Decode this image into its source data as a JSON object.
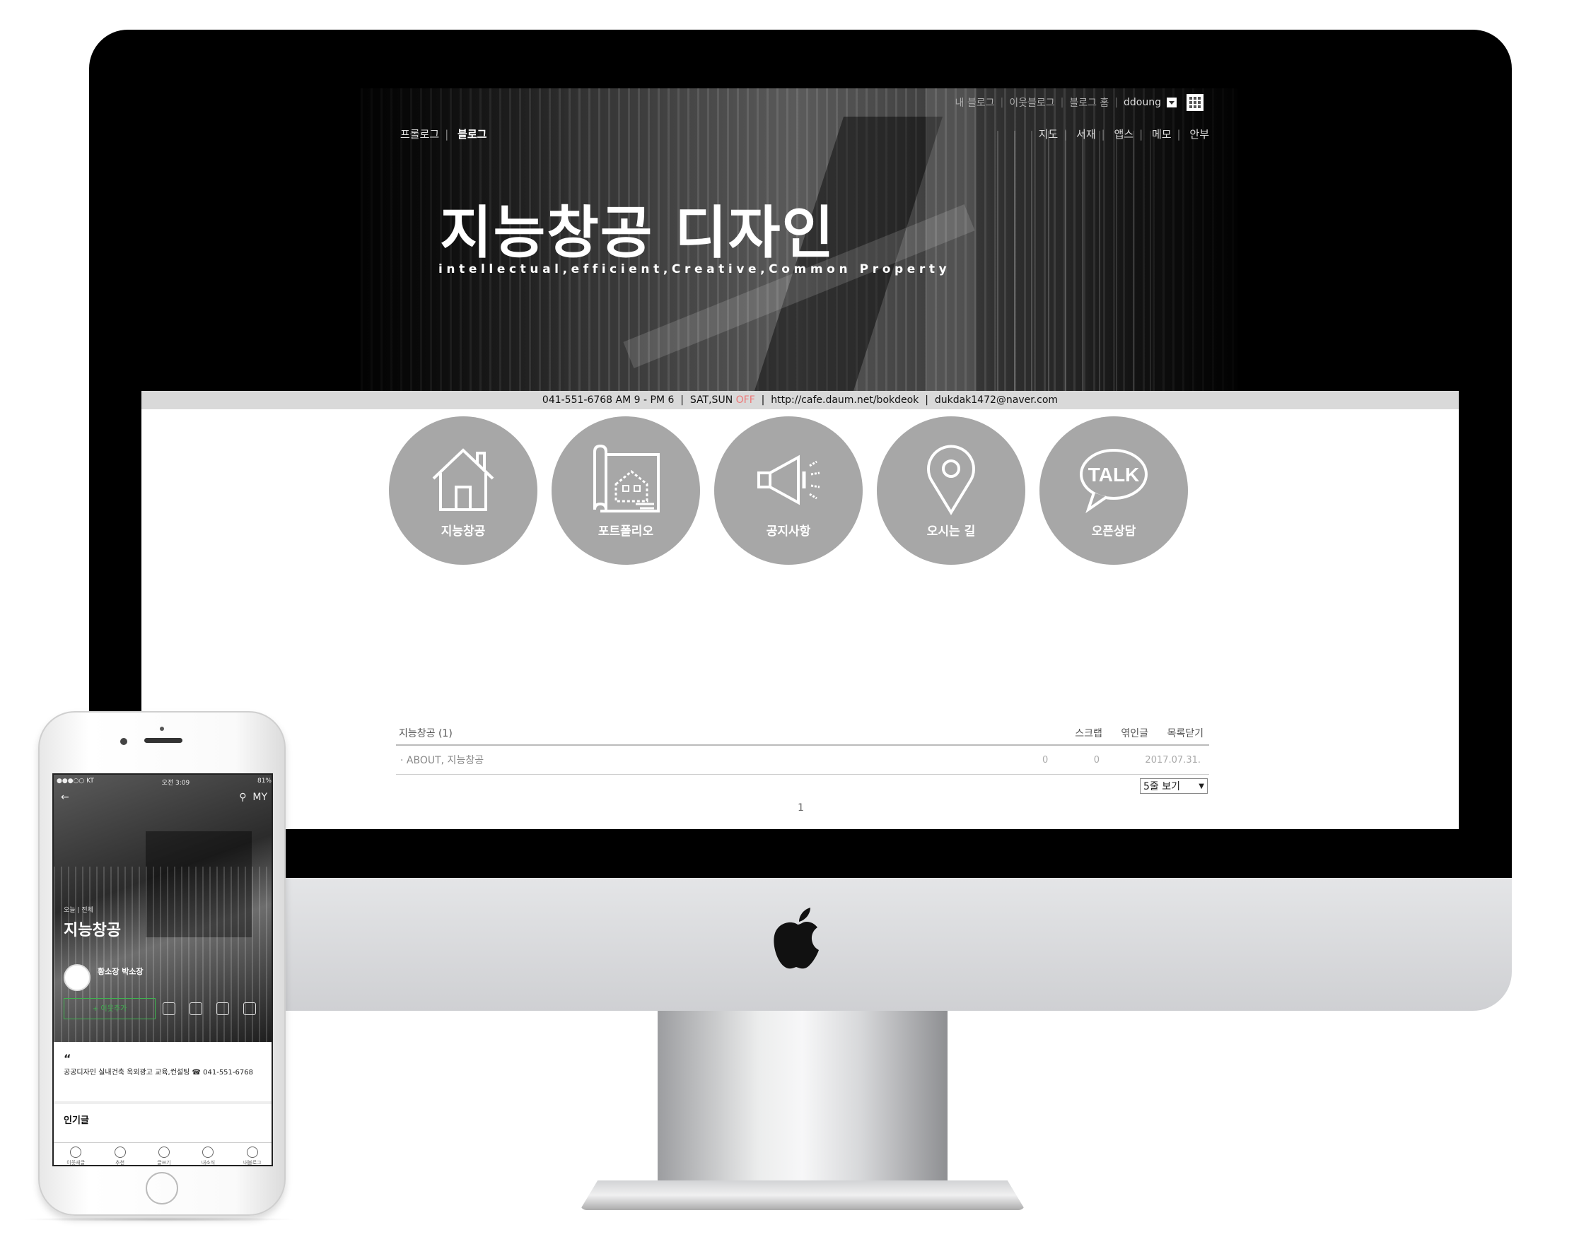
{
  "desktop": {
    "top_links": [
      "내 블로그",
      "이웃블로그",
      "블로그 홈"
    ],
    "user": "ddoung",
    "nav_left": [
      "프롤로그",
      "블로그"
    ],
    "nav_right": [
      "지도",
      "서재",
      "앱스",
      "메모",
      "안부"
    ],
    "title": "지능창공 디자인",
    "subtitle": "intellectual,efficient,Creative,Common Property",
    "infobar": {
      "hours": "041-551-6768 AM 9 - PM 6",
      "weekend": "SAT,SUN",
      "off": "OFF",
      "cafe": "http://cafe.daum.net/bokdeok",
      "email": "dukdak1472@naver.com"
    },
    "menu": [
      {
        "label": "지능창공",
        "icon": "house-icon"
      },
      {
        "label": "포트폴리오",
        "icon": "blueprint-icon"
      },
      {
        "label": "공지사항",
        "icon": "megaphone-icon"
      },
      {
        "label": "오시는 길",
        "icon": "location-pin-icon"
      },
      {
        "label": "오픈상담",
        "icon": "talk-bubble-icon",
        "icon_text": "TALK"
      }
    ],
    "list": {
      "category": "지능창공 (1)",
      "columns": [
        "스크랩",
        "엮인글",
        "목록닫기"
      ],
      "rows": [
        {
          "title": "ABOUT, 지능창공",
          "scrap": "0",
          "trackback": "0",
          "date": "2017.07.31."
        }
      ],
      "per_page": "5줄 보기",
      "page": "1"
    }
  },
  "mobile": {
    "status_left": "●●●○○ KT",
    "status_time": "오전 3:09",
    "status_right": "81%",
    "my": "MY",
    "breadcrumb": "오늘 | 전체",
    "title": "지능창공",
    "author": "황소장 박소장",
    "follow": "+ 이웃추가",
    "quote": "“",
    "description": "공공디자인 실내건축 옥외광고 교육,컨설팅 ☎ 041-551-6768",
    "popular": "인기글",
    "tabs": [
      "이웃새글",
      "추천",
      "글쓰기",
      "내소식",
      "내블로그"
    ]
  }
}
